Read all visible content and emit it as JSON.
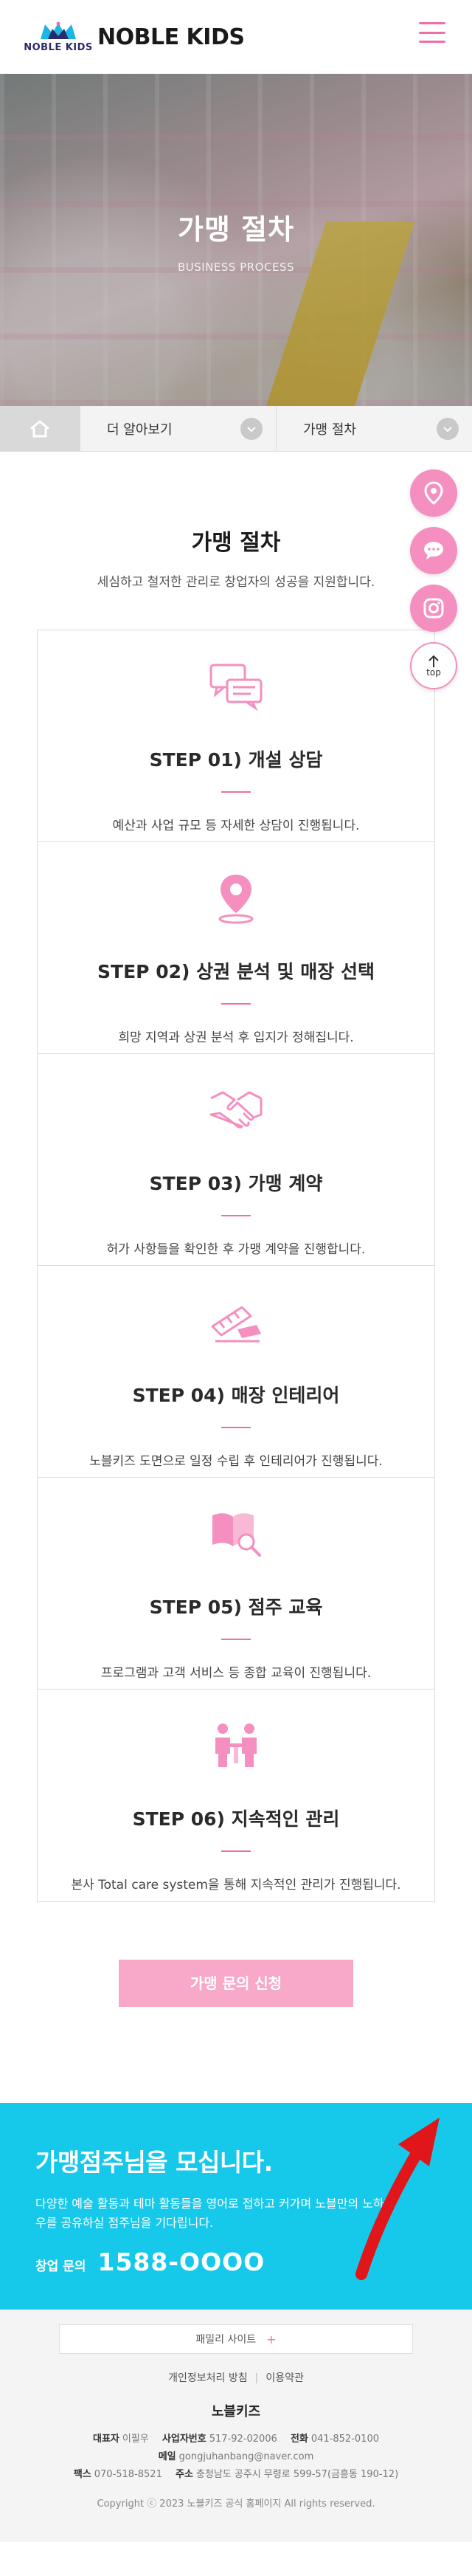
{
  "header": {
    "logo_text": "NOBLE KIDS",
    "title": "NOBLE KIDS",
    "menu_icon": "hamburger-icon"
  },
  "hero": {
    "title": "가맹 절차",
    "subtitle": "BUSINESS PROCESS"
  },
  "subnav": {
    "home_icon": "home-icon",
    "item1": "더 알아보기",
    "item2": "가맹 절차"
  },
  "quick_menu": {
    "top_label": "top",
    "icons": [
      "map-pin-icon",
      "chat-icon",
      "instagram-icon",
      "arrow-up-icon"
    ]
  },
  "section": {
    "title": "가맹 절차",
    "description": "세심하고 철저한 관리로 창업자의 성공을 지원합니다."
  },
  "steps": [
    {
      "title": "STEP 01) 개설 상담",
      "desc": "예산과 사업 규모 등 자세한 상담이 진행됩니다.",
      "icon": "chat-bubbles-icon"
    },
    {
      "title": "STEP 02) 상권 분석 및 매장 선택",
      "desc": "희망 지역과 상권 분석 후 입지가 정해집니다.",
      "icon": "location-pin-icon"
    },
    {
      "title": "STEP 03) 가맹 계약",
      "desc": "허가 사항들을 확인한 후 가맹 계약을 진행합니다.",
      "icon": "handshake-icon"
    },
    {
      "title": "STEP 04) 매장 인테리어",
      "desc": "노블키즈 도면으로 일정 수립 후 인테리어가 진행됩니다.",
      "icon": "tools-icon"
    },
    {
      "title": "STEP 05) 점주 교육",
      "desc": "프로그램과 고객 서비스 등 종합 교육이 진행됩니다.",
      "icon": "book-search-icon"
    },
    {
      "title": "STEP 06) 지속적인 관리",
      "desc": "본사 Total care system을 통해 지속적인 관리가 진행됩니다.",
      "icon": "meeting-icon"
    }
  ],
  "apply": {
    "label": "가맹 문의 신청"
  },
  "recruit": {
    "title": "가맹점주님을 모십니다.",
    "desc": "다양한 예술 활동과 테마 활동들을 영어로 접하고 커가며 노블만의 노하우를 공유하실 점주님을 기다립니다.",
    "call_label": "창업 문의",
    "call_number": "1588-OOOO"
  },
  "footer": {
    "family_site": "패밀리 사이트",
    "family_plus": "+",
    "privacy": "개인정보처리 방침",
    "terms": "이용약관",
    "company": "노블키즈",
    "ceo_label": "대표자",
    "ceo": "이필우",
    "biz_label": "사업자번호",
    "biz": "517-92-02006",
    "tel_label": "전화",
    "tel": "041-852-0100",
    "mail_label": "메일",
    "mail": "gongjuhanbang@naver.com",
    "fax_label": "팩스",
    "fax": "070-518-8521",
    "addr_label": "주소",
    "addr": "충청남도 공주시 무령로 599-57(금흥동 190-12)",
    "copyright": "Copyright ⓒ 2023 노블키즈 공식 홈페이지 All rights reserved."
  },
  "colors": {
    "accent": "#f06ea5",
    "pink_light": "#f8a9c9",
    "recruit_bg": "#16c8ea"
  }
}
